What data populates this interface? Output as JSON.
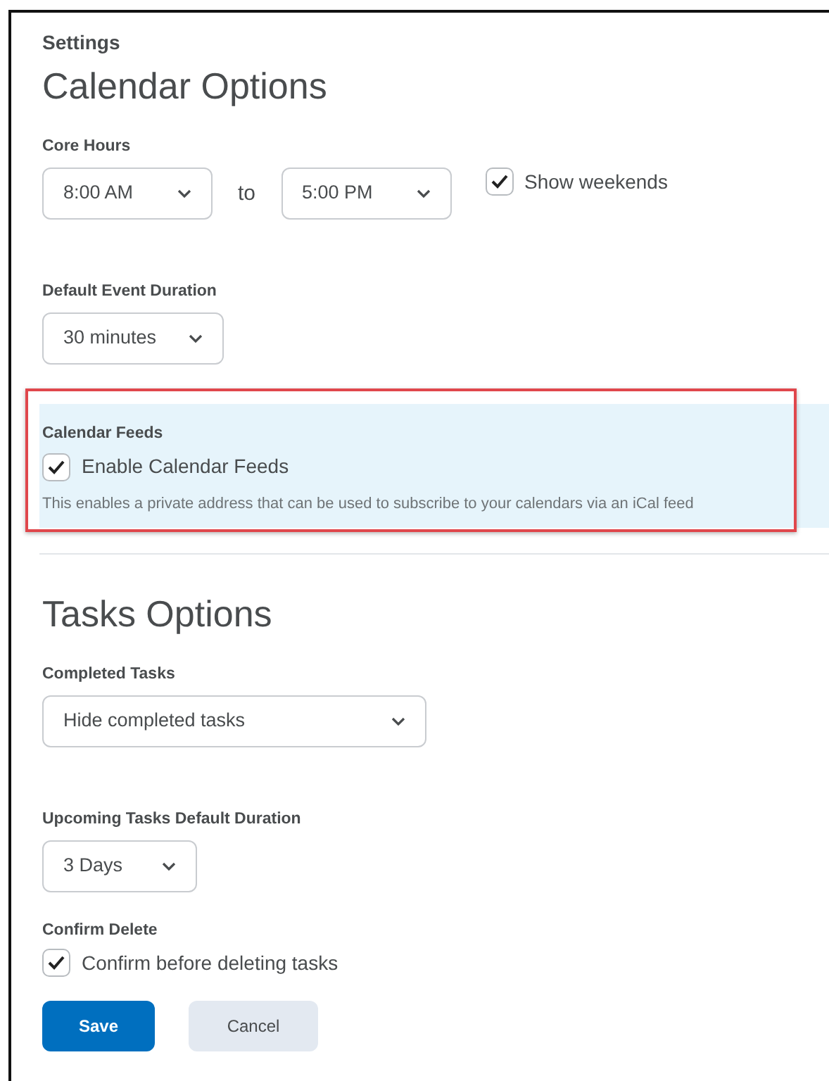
{
  "breadcrumb": "Settings",
  "sections": [
    {
      "title": "Calendar Options",
      "fields": [
        {
          "kind": "time-range",
          "label": "Core Hours",
          "from": "8:00 AM",
          "separator": "to",
          "to": "5:00 PM",
          "option": {
            "label": "Show weekends",
            "checked": true
          }
        },
        {
          "kind": "select",
          "label": "Default Event Duration",
          "value": "30 minutes"
        },
        {
          "kind": "checkbox",
          "label": "Calendar Feeds",
          "highlighted": true,
          "option": {
            "label": "Enable Calendar Feeds",
            "checked": true
          },
          "help": "This enables a private address that can be used to subscribe to your calendars via an iCal feed"
        }
      ]
    },
    {
      "title": "Tasks Options",
      "fields": [
        {
          "kind": "select",
          "label": "Completed Tasks",
          "value": "Hide completed tasks"
        },
        {
          "kind": "select",
          "label": "Upcoming Tasks Default Duration",
          "value": "3 Days"
        },
        {
          "kind": "checkbox",
          "label": "Confirm Delete",
          "option": {
            "label": "Confirm before deleting tasks",
            "checked": true
          }
        }
      ]
    }
  ],
  "buttons": [
    {
      "label": "Save",
      "kind": "primary"
    },
    {
      "label": "Cancel",
      "kind": "secondary"
    }
  ]
}
